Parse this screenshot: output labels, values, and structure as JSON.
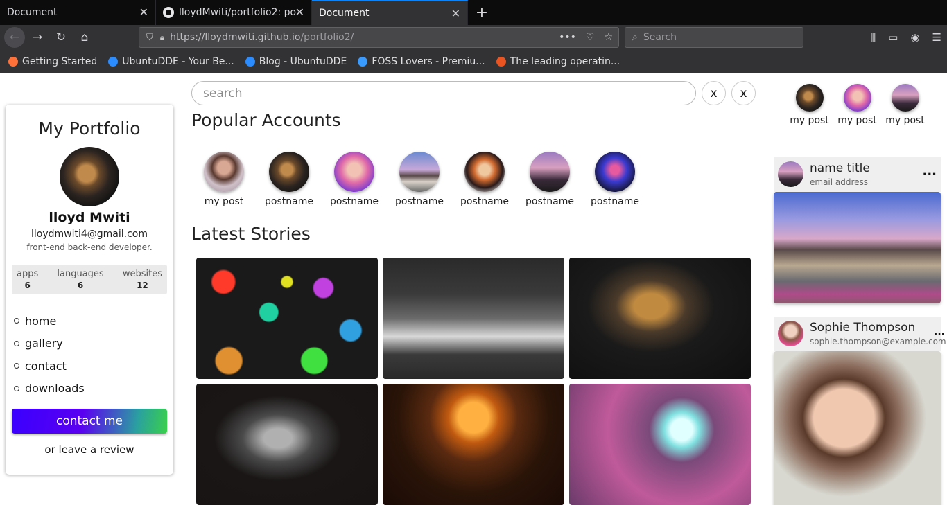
{
  "browser": {
    "tabs": [
      {
        "title": "Document",
        "active": false
      },
      {
        "title": "lloydMwiti/portfolio2: po",
        "active": false
      },
      {
        "title": "Document",
        "active": true
      }
    ],
    "url_host": "https://lloydmwiti.github.io",
    "url_path": "/portfolio2/",
    "search_placeholder": "Search",
    "bookmarks": [
      {
        "label": "Getting Started",
        "color": "#ff7139"
      },
      {
        "label": "UbuntuDDE - Your Be...",
        "color": "#2a8cff"
      },
      {
        "label": "Blog - UbuntuDDE",
        "color": "#2a8cff"
      },
      {
        "label": "FOSS Lovers - Premiu...",
        "color": "#3a9bff"
      },
      {
        "label": "The leading operatin...",
        "color": "#e95420"
      }
    ]
  },
  "profile": {
    "title": "My Portfolio",
    "name": "lloyd Mwiti",
    "email": "lloydmwiti4@gmail.com",
    "role": "front-end back-end developer.",
    "stats": [
      {
        "label": "apps",
        "value": "6"
      },
      {
        "label": "languages",
        "value": "6"
      },
      {
        "label": "websites",
        "value": "12"
      }
    ],
    "menu": [
      "home",
      "gallery",
      "contact",
      "downloads"
    ],
    "contact_label": "contact me",
    "review_label": "or leave a review"
  },
  "search": {
    "placeholder": "search",
    "clear_labels": [
      "x",
      "x"
    ]
  },
  "popular": {
    "title": "Popular Accounts",
    "accounts": [
      "my post",
      "postname",
      "postname",
      "postname",
      "postname",
      "postname",
      "postname"
    ]
  },
  "stories": {
    "title": "Latest Stories"
  },
  "mini_posts": [
    "my post",
    "my post",
    "my post"
  ],
  "posts": [
    {
      "name": "name title",
      "email": "email address",
      "more": "..."
    },
    {
      "name": "Sophie Thompson",
      "email": "sophie.thompson@example.com",
      "more": "..."
    }
  ]
}
